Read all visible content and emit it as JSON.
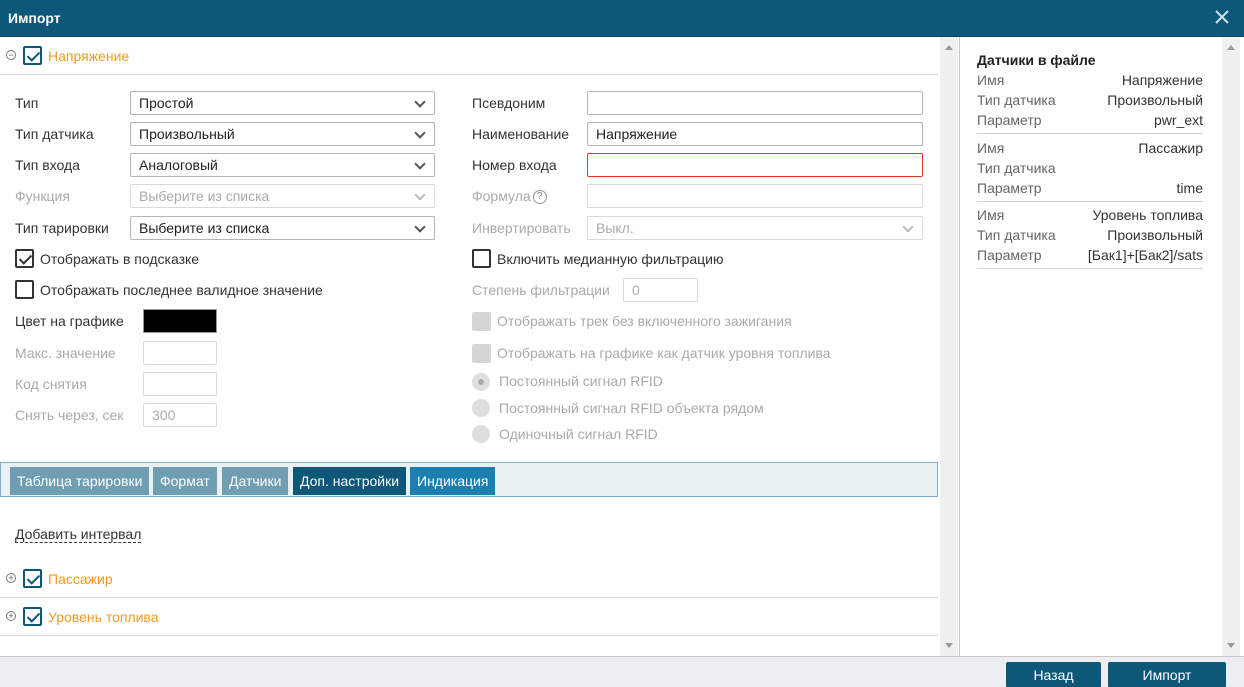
{
  "window": {
    "title": "Импорт"
  },
  "sections": {
    "voltage": {
      "name": "Напряжение"
    },
    "passenger": {
      "name": "Пассажир"
    },
    "fuel": {
      "name": "Уровень топлива"
    }
  },
  "form": {
    "type": {
      "label": "Тип",
      "value": "Простой"
    },
    "sensor_type": {
      "label": "Тип датчика",
      "value": "Произвольный"
    },
    "input_type": {
      "label": "Тип входа",
      "value": "Аналоговый"
    },
    "function": {
      "label": "Функция",
      "placeholder": "Выберите из списка"
    },
    "calibration_type": {
      "label": "Тип тарировки",
      "placeholder": "Выберите из списка"
    },
    "show_in_tooltip": {
      "label": "Отображать в подсказке"
    },
    "show_last_valid": {
      "label": "Отображать последнее валидное значение"
    },
    "chart_color": {
      "label": "Цвет на графике",
      "value": "#000000"
    },
    "max_value": {
      "label": "Макс. значение",
      "value": ""
    },
    "removal_code": {
      "label": "Код снятия",
      "value": ""
    },
    "remove_after": {
      "label": "Снять через, сек",
      "value": "300"
    },
    "alias": {
      "label": "Псевдоним",
      "value": ""
    },
    "name": {
      "label": "Наименование",
      "value": "Напряжение"
    },
    "input_number": {
      "label": "Номер входа",
      "value": ""
    },
    "formula": {
      "label": "Формула",
      "value": "",
      "help_glyph": "?"
    },
    "invert": {
      "label": "Инвертировать",
      "value": "Выкл."
    },
    "median_filter": {
      "label": "Включить медианную фильтрацию"
    },
    "filter_degree": {
      "label": "Степень фильтрации",
      "value": "0"
    },
    "track_no_ignition": {
      "label": "Отображать трек без включенного зажигания"
    },
    "as_fuel_sensor": {
      "label": "Отображать на графике как датчик уровня топлива"
    },
    "rfid_constant": {
      "label": "Постоянный сигнал RFID"
    },
    "rfid_nearby": {
      "label": "Постоянный сигнал RFID объекта рядом"
    },
    "rfid_single": {
      "label": "Одиночный сигнал RFID"
    }
  },
  "tabs": [
    "Таблица тарировки",
    "Формат",
    "Датчики",
    "Доп. настройки",
    "Индикация"
  ],
  "add_interval": "Добавить интервал",
  "file_sensors": {
    "title": "Датчики в файле",
    "groups": [
      {
        "rows": [
          {
            "k": "Имя",
            "v": "Напряжение"
          },
          {
            "k": "Тип датчика",
            "v": "Произвольный"
          },
          {
            "k": "Параметр",
            "v": "pwr_ext"
          }
        ]
      },
      {
        "rows": [
          {
            "k": "Имя",
            "v": "Пассажир"
          },
          {
            "k": "Тип датчика",
            "v": ""
          },
          {
            "k": "Параметр",
            "v": "time"
          }
        ]
      },
      {
        "rows": [
          {
            "k": "Имя",
            "v": "Уровень топлива"
          },
          {
            "k": "Тип датчика",
            "v": "Произвольный"
          },
          {
            "k": "Параметр",
            "v": "[Бак1]+[Бак2]/sats"
          }
        ]
      }
    ]
  },
  "footer": {
    "back": "Назад",
    "import": "Импорт"
  },
  "colors": {
    "header": "#0d5879",
    "accent": "#f29a1f",
    "error": "#e0392b"
  }
}
